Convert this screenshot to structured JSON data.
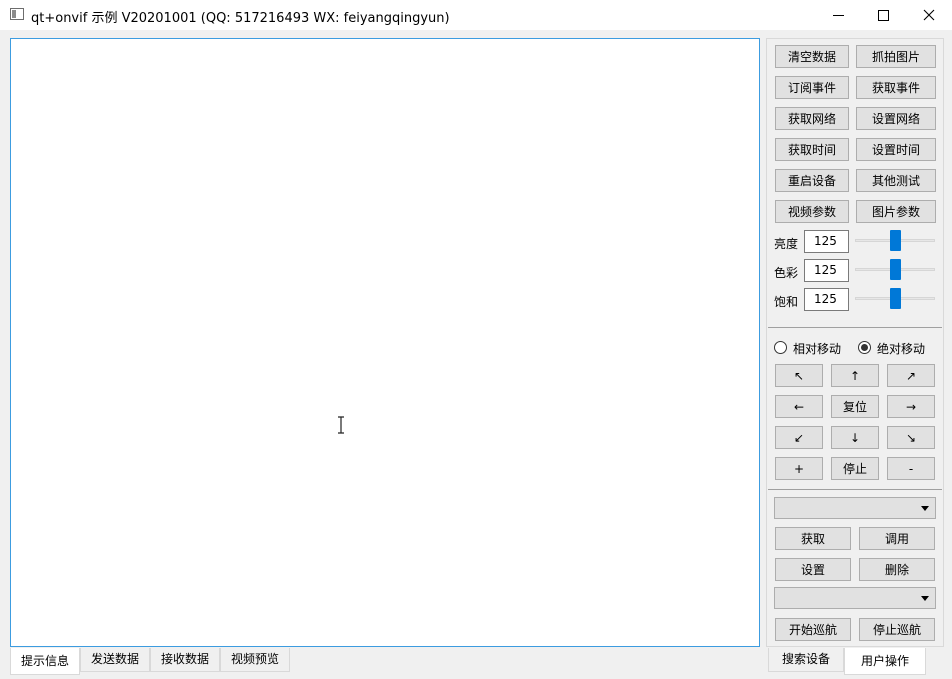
{
  "window": {
    "title": "qt+onvif 示例 V20201001 (QQ: 517216493 WX: feiyangqingyun)"
  },
  "left_tabs": [
    "提示信息",
    "发送数据",
    "接收数据",
    "视频预览"
  ],
  "right_tabs": [
    "搜索设备",
    "用户操作"
  ],
  "buttons": {
    "clear_data": "清空数据",
    "capture_image": "抓拍图片",
    "subscribe_event": "订阅事件",
    "get_event": "获取事件",
    "get_network": "获取网络",
    "set_network": "设置网络",
    "get_time": "获取时间",
    "set_time": "设置时间",
    "reboot_device": "重启设备",
    "other_test": "其他测试",
    "video_params": "视频参数",
    "image_params": "图片参数"
  },
  "image_settings": [
    {
      "label": "亮度",
      "value": "125"
    },
    {
      "label": "色彩",
      "value": "125"
    },
    {
      "label": "饱和",
      "value": "125"
    }
  ],
  "image_levels": [
    0.5,
    0.5,
    0.5
  ],
  "move_mode": {
    "relative": "相对移动",
    "absolute": "绝对移动",
    "selected": "absolute"
  },
  "ptz": {
    "up_left": "↖",
    "up": "↑",
    "up_right": "↗",
    "left": "←",
    "reset": "复位",
    "right": "→",
    "down_left": "↙",
    "down": "↓",
    "down_right": "↘",
    "zoom_in": "+",
    "stop": "停止",
    "zoom_out": "-"
  },
  "preset": {
    "get": "获取",
    "call": "调用",
    "set": "设置",
    "delete": "删除"
  },
  "tour": {
    "start": "开始巡航",
    "stop": "停止巡航"
  }
}
